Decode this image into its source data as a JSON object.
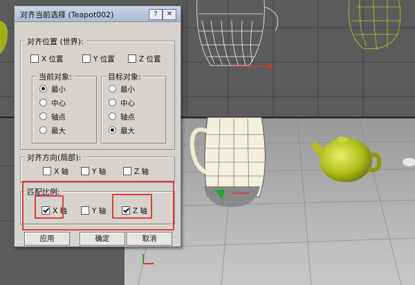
{
  "dialog": {
    "title": "对齐当前选择 (Teapot002)",
    "help_label": "?",
    "close_label": "✕",
    "align_position": {
      "title": "对齐位置 (世界):",
      "x_label": "X 位置",
      "y_label": "Y 位置",
      "z_label": "Z 位置"
    },
    "current_object": {
      "title": "当前对象:",
      "options": [
        "最小",
        "中心",
        "轴点",
        "最大"
      ],
      "selected": "最小"
    },
    "target_object": {
      "title": "目标对象:",
      "options": [
        "最小",
        "中心",
        "轴点",
        "最大"
      ],
      "selected": "最大"
    },
    "align_orientation": {
      "title": "对齐方向(局部):",
      "x_label": "X 轴",
      "y_label": "Y 轴",
      "z_label": "Z 轴"
    },
    "match_scale": {
      "title": "匹配比例:",
      "x_label": "X 轴",
      "y_label": "Y 轴",
      "z_label": "Z 轴",
      "x_checked": true,
      "y_checked": false,
      "z_checked": true
    },
    "buttons": {
      "apply": "应用",
      "ok": "确定",
      "cancel": "取消"
    }
  },
  "colors": {
    "highlight": "#e2393c",
    "viewport_bg": "#5a5a5a",
    "grid": "#3f3f3f",
    "teapot_yellow": "#b5c21d",
    "teapot_white": "#f2f1e6"
  }
}
